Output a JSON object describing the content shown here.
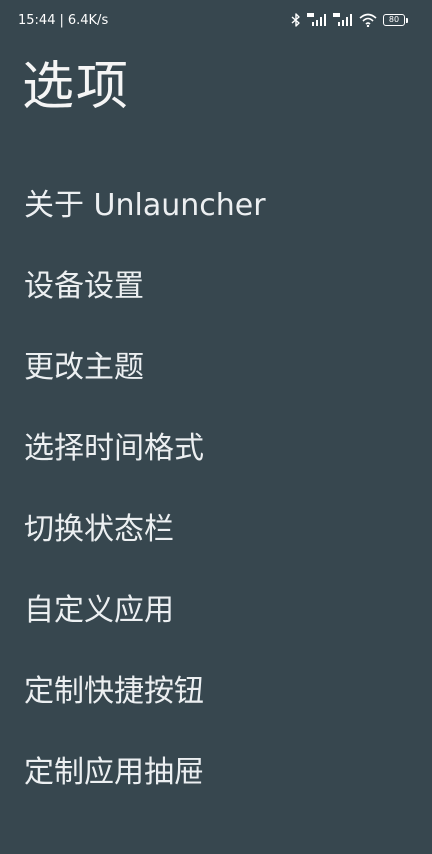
{
  "status_bar": {
    "time": "15:44",
    "separator": "|",
    "network_speed": "6.4K/s",
    "icons": [
      "bluetooth-icon",
      "signal-hd-icon",
      "signal-hd-icon",
      "wifi-icon"
    ],
    "battery_level": "80"
  },
  "page": {
    "title": "选项"
  },
  "menu": {
    "items": [
      {
        "label": "关于 Unlauncher"
      },
      {
        "label": "设备设置"
      },
      {
        "label": "更改主题"
      },
      {
        "label": "选择时间格式"
      },
      {
        "label": "切换状态栏"
      },
      {
        "label": "自定义应用"
      },
      {
        "label": "定制快捷按钮"
      },
      {
        "label": "定制应用抽屉"
      }
    ]
  },
  "colors": {
    "background": "#37474F",
    "text": "#ECEFF1"
  }
}
